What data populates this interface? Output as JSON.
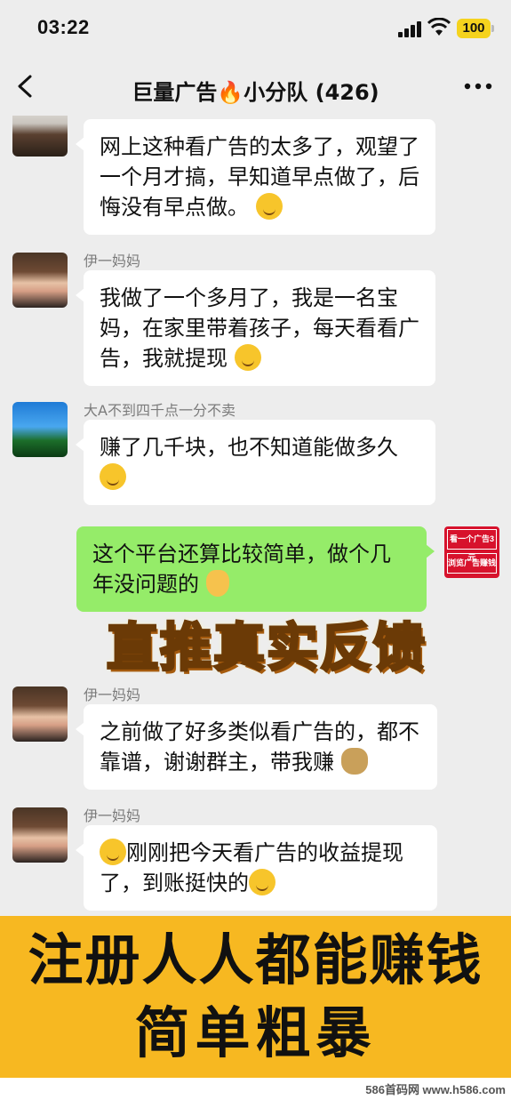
{
  "status_bar": {
    "time": "03:22",
    "battery": "100"
  },
  "nav": {
    "title": "巨量广告🔥小分队 (426)",
    "back_icon": "chevron-left-icon",
    "more_icon": "ellipsis-icon"
  },
  "messages": [
    {
      "sender": "",
      "text": "网上这种看广告的太多了，观望了一个月才搞，早知道早点做了，后悔没有早点做。",
      "emoji": "sweat-smile",
      "avatar": "man-with-gun"
    },
    {
      "sender": "伊一妈妈",
      "text": "我做了一个多月了，我是一名宝妈，在家里带着孩子，每天看看广告，我就提现",
      "emoji": "thinking",
      "avatar": "girl"
    },
    {
      "sender": "大A不到四千点一分不卖",
      "text": "赚了几千块，也不知道能做多久",
      "emoji": "grin",
      "avatar": "palm-trees"
    },
    {
      "sender": "",
      "text": "这个平台还算比较简单，做个几年没问题的",
      "emoji": "victory-hand",
      "avatar": "ad-badge",
      "mine": true
    },
    {
      "sender": "伊一妈妈",
      "text": "之前做了好多类似看广告的，都不靠谱，谢谢群主，带我赚",
      "emoji": "money-bag",
      "avatar": "girl"
    },
    {
      "sender": "伊一妈妈",
      "text": "刚刚把今天看广告的收益提现了，到账挺快的",
      "emoji": "grin",
      "avatar": "girl"
    }
  ],
  "ad_badge": {
    "line1": "看一个广告3元",
    "line2": "浏览广告赚钱"
  },
  "banner": "直推真实反馈",
  "promo": {
    "line1": "注册人人都能赚钱",
    "line2": "简单粗暴"
  },
  "watermark": "586首码网 www.h586.com",
  "colors": {
    "background": "#ededed",
    "my_bubble": "#95ec69",
    "promo_bg": "#f7b821",
    "badge_red": "#d7122c"
  }
}
